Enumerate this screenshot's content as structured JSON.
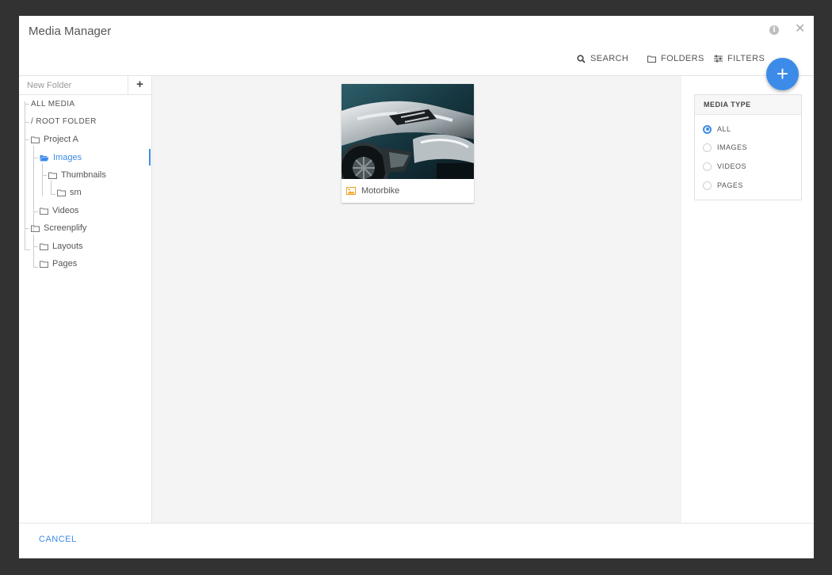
{
  "dialog": {
    "title": "Media Manager"
  },
  "toolbar": {
    "search_label": "SEARCH",
    "folders_label": "FOLDERS",
    "filters_label": "FILTERS"
  },
  "sidebar": {
    "new_folder_placeholder": "New Folder",
    "tree": [
      {
        "label": "ALL MEDIA",
        "level": 0,
        "icon": "none"
      },
      {
        "label": "/ ROOT FOLDER",
        "level": 0,
        "icon": "none"
      },
      {
        "label": "Project A",
        "level": 0,
        "icon": "folder-icon"
      },
      {
        "label": "Images",
        "level": 1,
        "icon": "folder-open-icon",
        "active": true
      },
      {
        "label": "Thumbnails",
        "level": 2,
        "icon": "folder-icon"
      },
      {
        "label": "sm",
        "level": 3,
        "icon": "folder-icon"
      },
      {
        "label": "Videos",
        "level": 1,
        "icon": "folder-icon"
      },
      {
        "label": "Screenplify",
        "level": 0,
        "icon": "folder-icon"
      },
      {
        "label": "Layouts",
        "level": 1,
        "icon": "folder-icon"
      },
      {
        "label": "Pages",
        "level": 1,
        "icon": "folder-icon"
      }
    ]
  },
  "media": [
    {
      "name": "Motorbike",
      "type_icon": "image-icon"
    }
  ],
  "filters": {
    "title": "MEDIA TYPE",
    "options": [
      {
        "label": "ALL",
        "checked": true
      },
      {
        "label": "IMAGES",
        "checked": false
      },
      {
        "label": "VIDEOS",
        "checked": false
      },
      {
        "label": "PAGES",
        "checked": false
      }
    ]
  },
  "footer": {
    "cancel_label": "CANCEL"
  },
  "colors": {
    "accent": "#3d8be8",
    "backdrop": "#323232",
    "content_bg": "#f4f4f4",
    "image_icon": "#f0a020"
  }
}
